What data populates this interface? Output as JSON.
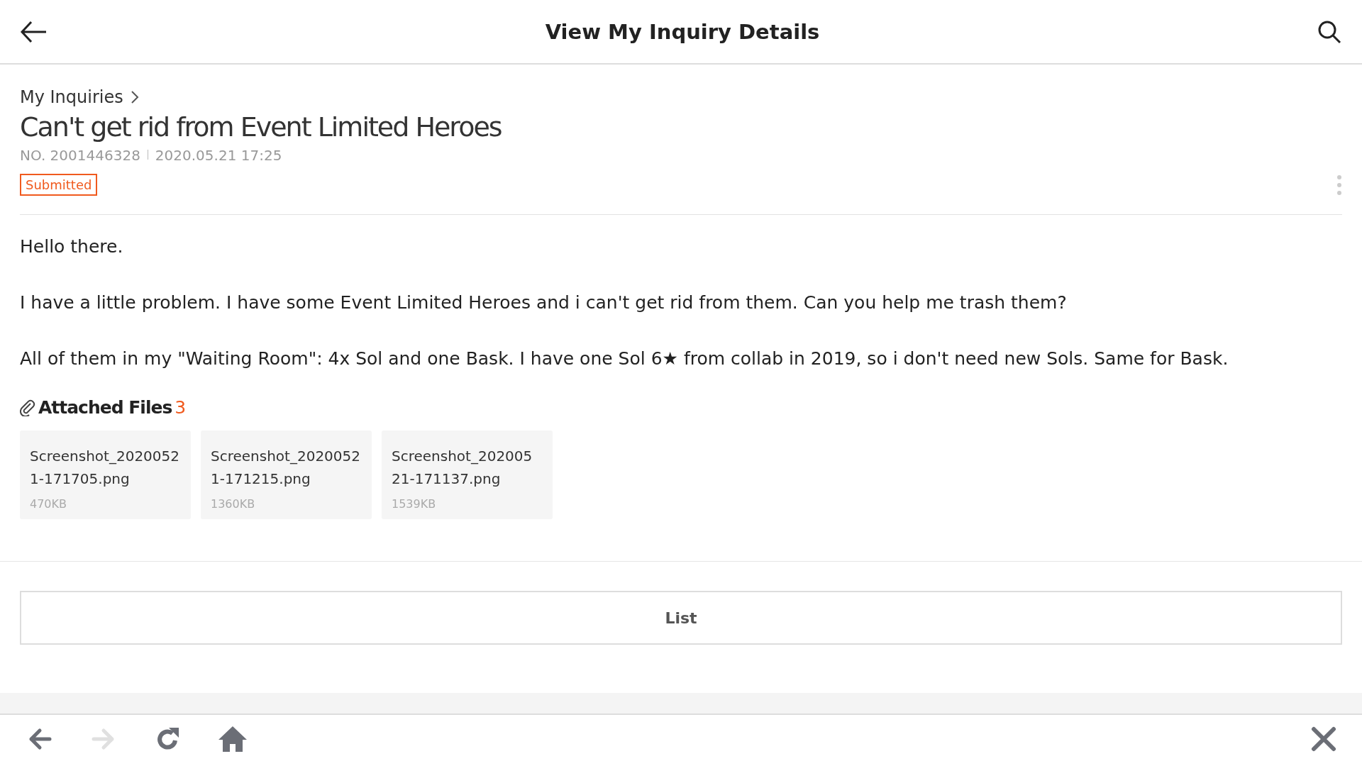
{
  "header": {
    "title": "View My Inquiry Details"
  },
  "breadcrumb": {
    "label": "My Inquiries"
  },
  "inquiry": {
    "title": "Can't get rid from Event Limited Heroes",
    "number": "NO. 2001446328",
    "date": "2020.05.21 17:25",
    "status": "Submitted"
  },
  "body": [
    "Hello there.",
    "I have a little problem. I have some Event Limited Heroes and i can't get rid from them. Can you help me trash them?",
    "All of them in my \"Waiting Room\": 4x Sol and one Bask. I have one Sol 6★ from collab in 2019, so i don't need new Sols. Same for Bask."
  ],
  "attachments": {
    "label": "Attached Files",
    "count": "3",
    "files": [
      {
        "name_lines": [
          "Screenshot_2020052",
          "1-171705.png"
        ],
        "size": "470KB"
      },
      {
        "name_lines": [
          "Screenshot_2020052",
          "1-171215.png"
        ],
        "size": "1360KB"
      },
      {
        "name_lines": [
          "Screenshot_202005",
          "21-171137.png"
        ],
        "size": "1539KB"
      }
    ]
  },
  "list_button": "List",
  "toolbar": [
    {
      "kind": "back",
      "disabled": false
    },
    {
      "kind": "forward",
      "disabled": true
    },
    {
      "kind": "reload",
      "disabled": false
    },
    {
      "kind": "home",
      "disabled": false
    },
    {
      "kind": "close",
      "disabled": false
    }
  ]
}
